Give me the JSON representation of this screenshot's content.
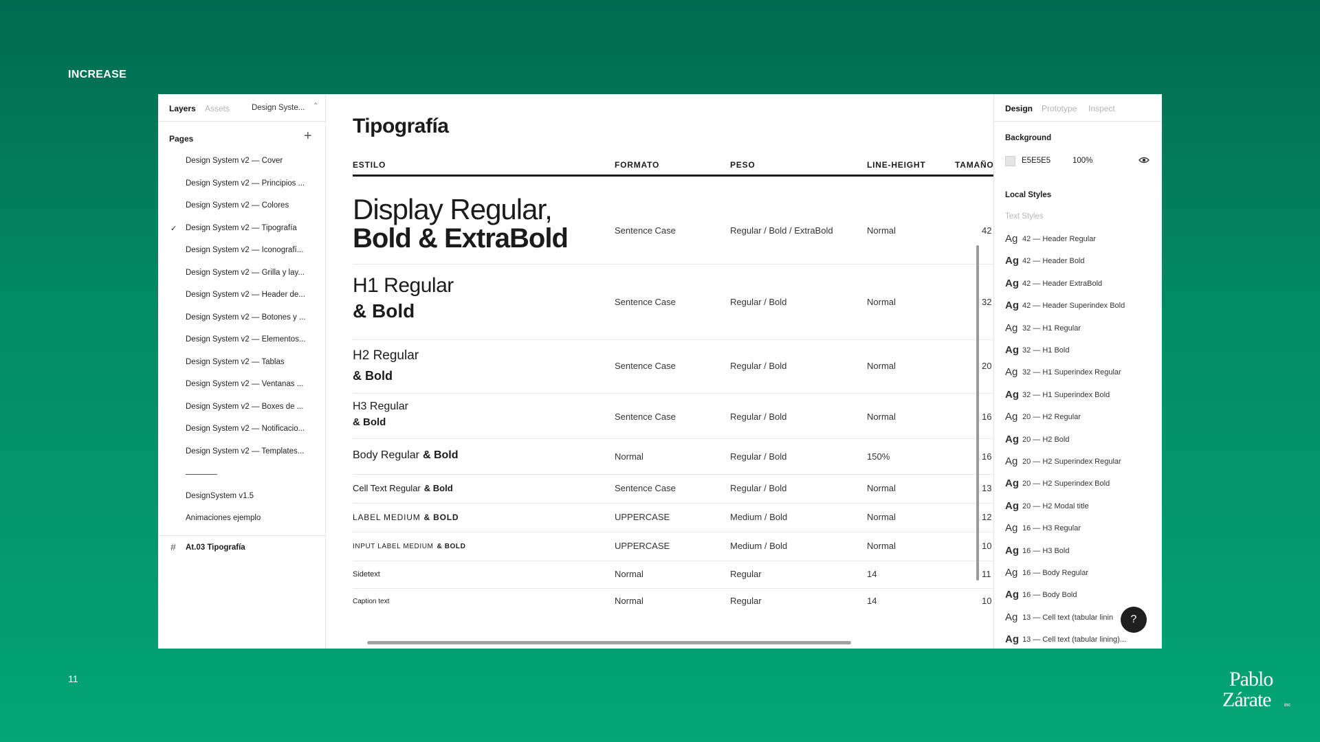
{
  "slide": {
    "title": "INCREASE",
    "number": "11",
    "logo_text_top": "Pablo",
    "logo_text_bottom": "Zárate",
    "logo_suffix": "inc"
  },
  "left_panel": {
    "tabs": {
      "layers": "Layers",
      "assets": "Assets",
      "file": "Design Syste..."
    },
    "pages_label": "Pages",
    "pages": [
      {
        "label": "Design System v2 — Cover",
        "selected": false
      },
      {
        "label": "Design System v2 — Principios ...",
        "selected": false
      },
      {
        "label": "Design System v2 — Colores",
        "selected": false
      },
      {
        "label": "Design System v2 — Tipografía",
        "selected": true
      },
      {
        "label": "Design System v2 — Iconografí...",
        "selected": false
      },
      {
        "label": "Design System v2 — Grilla y lay...",
        "selected": false
      },
      {
        "label": "Design System v2 — Header de...",
        "selected": false
      },
      {
        "label": "Design System v2 — Botones y ...",
        "selected": false
      },
      {
        "label": "Design System v2 — Elementos...",
        "selected": false
      },
      {
        "label": "Design System v2 — Tablas",
        "selected": false
      },
      {
        "label": "Design System v2 — Ventanas ...",
        "selected": false
      },
      {
        "label": "Design System v2 — Boxes de ...",
        "selected": false
      },
      {
        "label": "Design System v2 — Notificacio...",
        "selected": false
      },
      {
        "label": "Design System v2 — Templates...",
        "selected": false
      }
    ],
    "other_pages": [
      "DesignSystem v1.5",
      "Animaciones ejemplo"
    ],
    "frame": "At.03 Tipografía"
  },
  "canvas": {
    "title": "Tipografía",
    "headers": [
      "ESTILO",
      "FORMATO",
      "PESO",
      "LINE-HEIGHT",
      "TAMAÑO"
    ],
    "rows": [
      {
        "style_a": "Display Regular,",
        "style_b": "Bold & ExtraBold",
        "formato": "Sentence Case",
        "peso": "Regular / Bold / ExtraBold",
        "lh": "Normal",
        "size": "42"
      },
      {
        "style_a": "H1 Regular",
        "style_b": "& Bold",
        "formato": "Sentence Case",
        "peso": "Regular / Bold",
        "lh": "Normal",
        "size": "32"
      },
      {
        "style_a": "H2 Regular",
        "style_b": "& Bold",
        "formato": "Sentence Case",
        "peso": "Regular / Bold",
        "lh": "Normal",
        "size": "20"
      },
      {
        "style_a": "H3 Regular",
        "style_b": "& Bold",
        "formato": "Sentence Case",
        "peso": "Regular / Bold",
        "lh": "Normal",
        "size": "16"
      },
      {
        "style_a": "Body Regular",
        "style_b": "& Bold",
        "formato": "Normal",
        "peso": "Regular / Bold",
        "lh": "150%",
        "size": "16"
      },
      {
        "style_a": "Cell Text Regular",
        "style_b": "& Bold",
        "formato": "Sentence Case",
        "peso": "Regular / Bold",
        "lh": "Normal",
        "size": "13"
      },
      {
        "style_a": "LABEL MEDIUM",
        "style_b": "& BOLD",
        "formato": "UPPERCASE",
        "peso": "Medium / Bold",
        "lh": "Normal",
        "size": "12"
      },
      {
        "style_a": "INPUT LABEL MEDIUM",
        "style_b": "& BOLD",
        "formato": "UPPERCASE",
        "peso": "Medium / Bold",
        "lh": "Normal",
        "size": "10"
      },
      {
        "style_a": "Sidetext",
        "style_b": "",
        "formato": "Normal",
        "peso": "Regular",
        "lh": "14",
        "size": "11"
      },
      {
        "style_a": "Caption text",
        "style_b": "",
        "formato": "Normal",
        "peso": "Regular",
        "lh": "14",
        "size": "10"
      }
    ]
  },
  "right_panel": {
    "tabs": {
      "design": "Design",
      "prototype": "Prototype",
      "inspect": "Inspect"
    },
    "background_label": "Background",
    "background_hex": "E5E5E5",
    "background_opacity": "100%",
    "local_styles_label": "Local Styles",
    "text_styles_label": "Text Styles",
    "ag": "Ag",
    "styles": [
      {
        "name": "42 — Header Regular",
        "bold": false
      },
      {
        "name": "42 — Header Bold",
        "bold": true
      },
      {
        "name": "42 — Header ExtraBold",
        "bold": true
      },
      {
        "name": "42 — Header Superindex Bold",
        "bold": true
      },
      {
        "name": "32 — H1 Regular",
        "bold": false
      },
      {
        "name": "32 — H1 Bold",
        "bold": true
      },
      {
        "name": "32 — H1 Superindex Regular",
        "bold": false
      },
      {
        "name": "32 — H1 Superindex Bold",
        "bold": true
      },
      {
        "name": "20 — H2 Regular",
        "bold": false
      },
      {
        "name": "20 — H2 Bold",
        "bold": true
      },
      {
        "name": "20 — H2 Superindex Regular",
        "bold": false
      },
      {
        "name": "20 — H2 Superindex Bold",
        "bold": true
      },
      {
        "name": "20 — H2 Modal title",
        "bold": true
      },
      {
        "name": "16 — H3 Regular",
        "bold": false
      },
      {
        "name": "16 — H3 Bold",
        "bold": true
      },
      {
        "name": "16 — Body Regular",
        "bold": false
      },
      {
        "name": "16 — Body Bold",
        "bold": true
      },
      {
        "name": "13 — Cell text (tabular linin",
        "bold": false
      },
      {
        "name": "13 — Cell text (tabular lining)...",
        "bold": true
      }
    ],
    "help": "?"
  },
  "colors": {
    "bg_top": "#006a4f",
    "bg_bottom": "#03a575",
    "panel_border": "#e5e5e5"
  }
}
